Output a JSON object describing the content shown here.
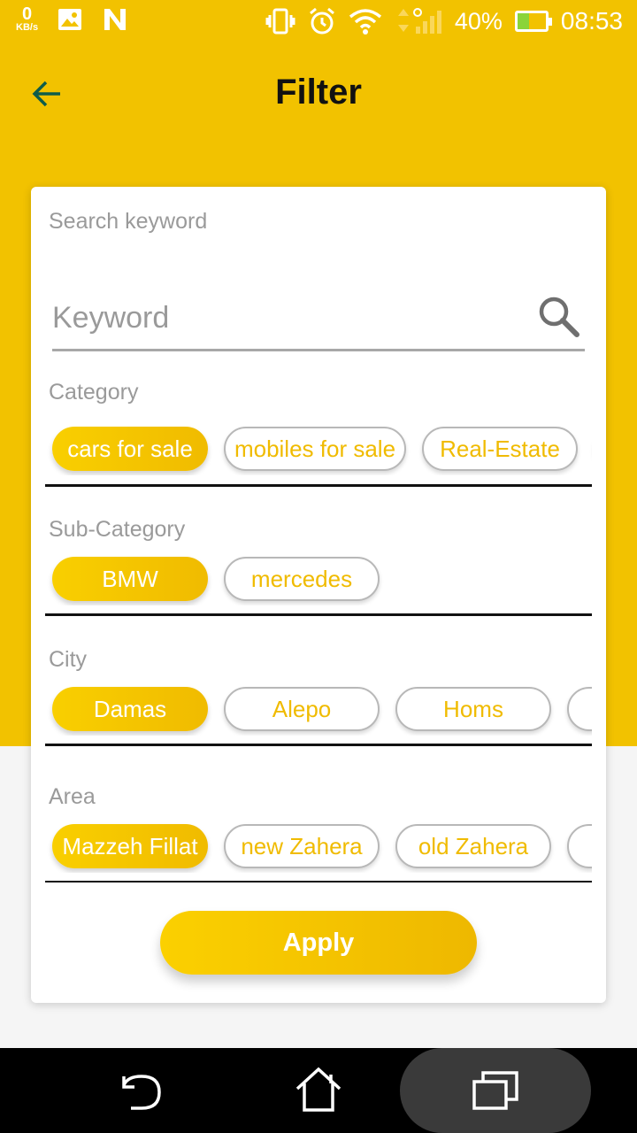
{
  "status_bar": {
    "kbs_value": "0",
    "kbs_unit": "KB/s",
    "battery_percent": "40%",
    "time": "08:53"
  },
  "toolbar": {
    "title": "Filter"
  },
  "search": {
    "label": "Search keyword",
    "placeholder": "Keyword"
  },
  "sections": {
    "category": {
      "label": "Category",
      "chips": [
        "cars for sale",
        "mobiles for sale",
        "Real-Estate"
      ],
      "selected": "cars for sale"
    },
    "sub_category": {
      "label": "Sub-Category",
      "chips": [
        "BMW",
        "mercedes"
      ],
      "selected": "BMW"
    },
    "city": {
      "label": "City",
      "chips": [
        "Damas",
        "Alepo",
        "Homs"
      ],
      "selected": "Damas"
    },
    "area": {
      "label": "Area",
      "chips": [
        "Mazzeh Fillat",
        "new Zahera",
        "old Zahera"
      ],
      "selected": "Mazzeh Fillat"
    }
  },
  "apply_label": "Apply",
  "colors": {
    "primary": "#f2c200",
    "chip_text": "#f0bb00",
    "label_gray": "#9a9a9a"
  },
  "nav_icons": [
    "back-icon",
    "home-icon",
    "recents-icon"
  ]
}
